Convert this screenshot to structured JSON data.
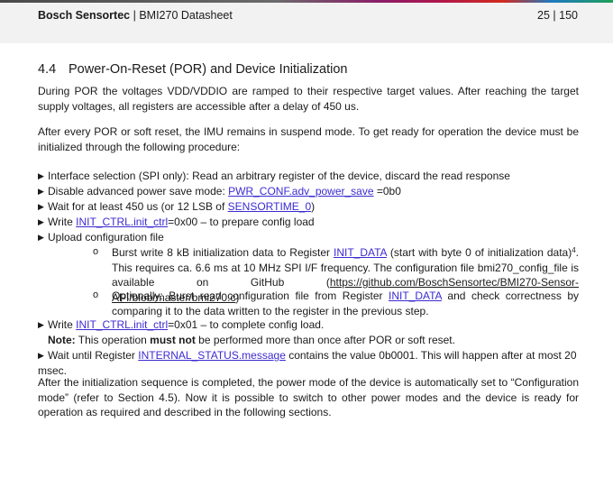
{
  "header": {
    "brand": "Bosch Sensortec",
    "separator": " | ",
    "doc": "BMI270 Datasheet",
    "page": "25 | 150"
  },
  "section": {
    "number": "4.4",
    "title": "Power-On-Reset (POR) and Device Initialization"
  },
  "para1": "During POR the voltages VDD/VDDIO are ramped to their respective target values. After reaching the target supply voltages, all registers are accessible after a delay of 450 us.",
  "para2": "After every POR or soft reset, the IMU remains in suspend mode. To get ready for operation the device must be initialized through the following procedure:",
  "bullets": {
    "b1": "Interface selection (SPI only): Read an arbitrary register of the device, discard the read response",
    "b2_pre": "Disable advanced power save mode: ",
    "b2_link": "PWR_CONF.adv_power_save",
    "b2_post": " =0b0",
    "b3_pre": "Wait for at least 450 us (or 12 LSB of ",
    "b3_link": "SENSORTIME_0",
    "b3_post": ")",
    "b4_pre": "Write ",
    "b4_link": "INIT_CTRL.init_ctrl",
    "b4_post": "=0x00 – to prepare config load",
    "b5": "Upload configuration file",
    "s1_pre": "Burst write 8 kB  initialization data to Register ",
    "s1_link": "INIT_DATA",
    "s1_mid": " (start with byte 0 of initialization data)",
    "s1_sup": "4",
    "s1_post": ". This requires ca. 6.6 ms at 10 MHz SPI I/F frequency. The configuration file bmi270_config_file is available on GitHub (",
    "s1_url": "https://github.com/BoschSensortec/BMI270-Sensor-API/blob/master/bmi270.c",
    "s1_end": ")",
    "s2_pre": "Optionally: Burst read configuration file from Register ",
    "s2_link": "INIT_DATA",
    "s2_post": " and check correctness by comparing it to the data written to the register in the previous step.",
    "b6_pre": "Write ",
    "b6_link": "INIT_CTRL.init_ctrl",
    "b6_post": "=0x01 – to complete config load.",
    "note_label": "Note:",
    "note_pre": " This operation ",
    "note_bold": "must not",
    "note_post": " be performed more than once after POR or soft reset.",
    "b7_pre": "Wait until Register ",
    "b7_link": "INTERNAL_STATUS.message",
    "b7_post": " contains the value 0b0001. This will happen after at most 20 msec."
  },
  "para3": "After the initialization sequence is completed, the power mode of the device is automatically set to “Configuration mode” (refer to Section 4.5). Now it is possible to switch to other power modes and the device is ready for operation as required and described in the following sections.",
  "icons": {
    "bullet": "▶",
    "sub_bullet": "o"
  },
  "colors": {
    "link": "#3b2bd0",
    "header_bg": "#f2f2f2"
  }
}
